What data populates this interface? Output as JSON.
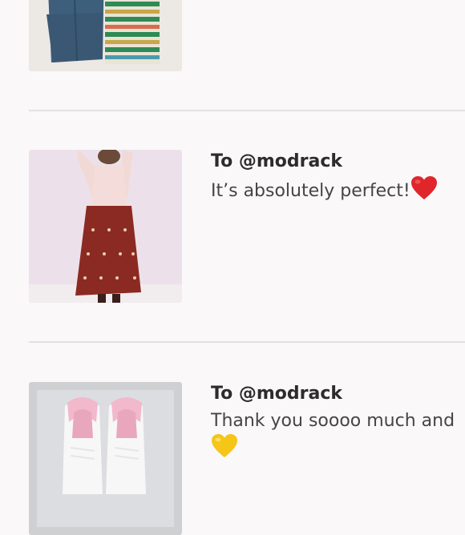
{
  "reviews": [
    {
      "image": "denim jeans and striped top flat-lay",
      "recipient": "",
      "message": ""
    },
    {
      "image": "woman in pink top and red patterned midi skirt",
      "recipient": "To @modrack",
      "message": "It’s absolutely perfect!",
      "emoji": "red-heart"
    },
    {
      "image": "white sneakers with pink heels",
      "recipient": "To @modrack",
      "message": "Thank you soooo much and",
      "emoji": "yellow-heart"
    }
  ],
  "colors": {
    "background": "#faf8f9",
    "divider": "#e2e0e1",
    "text": "#333333"
  }
}
